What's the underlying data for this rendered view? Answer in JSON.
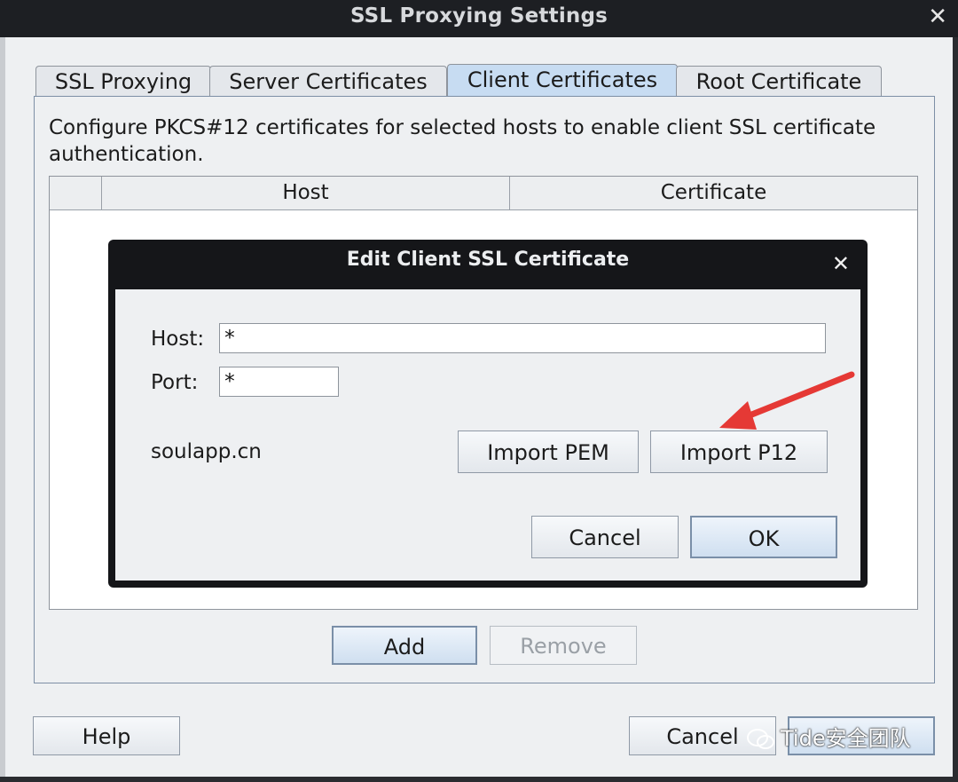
{
  "window": {
    "title": "SSL Proxying Settings",
    "tabs": [
      {
        "label": "SSL Proxying",
        "active": false
      },
      {
        "label": "Server Certificates",
        "active": false
      },
      {
        "label": "Client Certificates",
        "active": true
      },
      {
        "label": "Root Certificate",
        "active": false
      }
    ],
    "description": "Configure PKCS#12 certificates for selected hosts to enable client SSL certificate authentication.",
    "table": {
      "columns": [
        "",
        "Host",
        "Certificate"
      ]
    },
    "add_label": "Add",
    "remove_label": "Remove",
    "help_label": "Help",
    "cancel_label": "Cancel"
  },
  "dialog": {
    "title": "Edit Client SSL Certificate",
    "host_label": "Host:",
    "host_value": "*",
    "port_label": "Port:",
    "port_value": "*",
    "current_cert": "soulapp.cn",
    "import_pem_label": "Import PEM",
    "import_p12_label": "Import P12",
    "cancel_label": "Cancel",
    "ok_label": "OK"
  },
  "watermark": {
    "text": "Tide安全团队"
  },
  "colors": {
    "active_tab": "#c7dcf2",
    "annotation_arrow": "#e53935",
    "titlebar": "#1d1f23"
  }
}
